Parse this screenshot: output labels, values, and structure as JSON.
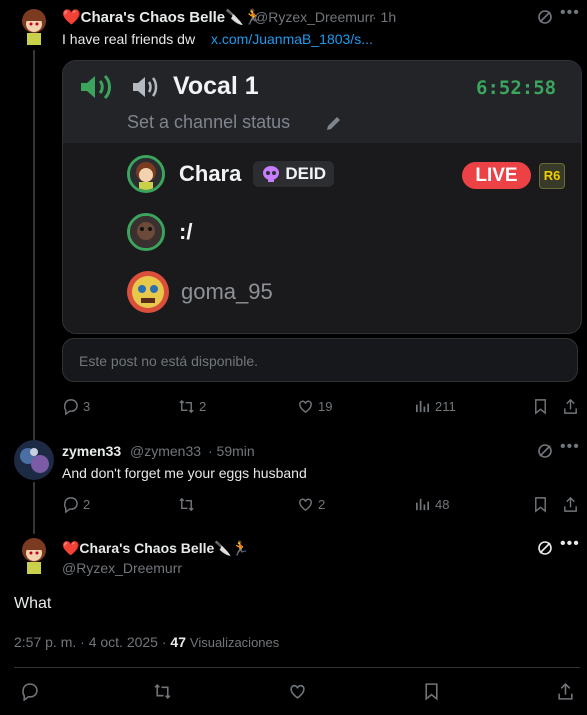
{
  "post1": {
    "display_name": "❤️Chara's Chaos Belle🔪🏃",
    "handle": "@Ryzex_Dreemurr",
    "time": "· 1h",
    "text": "I have real friends dw",
    "link": "x.com/JuanmaB_1803/s...",
    "card": {
      "channel": "Vocal 1",
      "timer": "6:52:58",
      "status_placeholder": "Set a channel status",
      "users": [
        {
          "name": "Chara",
          "badge": "DEID",
          "live": "LIVE",
          "tag": "R6"
        },
        {
          "name": ":/"
        },
        {
          "name": "goma_95"
        }
      ]
    },
    "unavailable": "Este post no está disponible.",
    "actions": {
      "replies": "3",
      "reposts": "2",
      "likes": "19",
      "views": "211"
    }
  },
  "post2": {
    "display_name": "zymen33",
    "handle": "@zymen33",
    "time": "· 59min",
    "text": "And don't forget me your eggs husband",
    "actions": {
      "replies": "2",
      "reposts": "",
      "likes": "2",
      "views": "48"
    }
  },
  "post3": {
    "display_name": "❤️Chara's Chaos Belle🔪🏃",
    "handle": "@Ryzex_Dreemurr",
    "text": "What",
    "timestamp": "2:57 p. m. · 4 oct. 2025 ·",
    "views_count": "47",
    "views_label": "Visualizaciones"
  },
  "colors": {
    "background": "#000000",
    "text": "#e7e9ea",
    "muted": "#71767b",
    "link": "#1d9bf0",
    "discord_green": "#3ba55d",
    "live_red": "#ed4245"
  }
}
